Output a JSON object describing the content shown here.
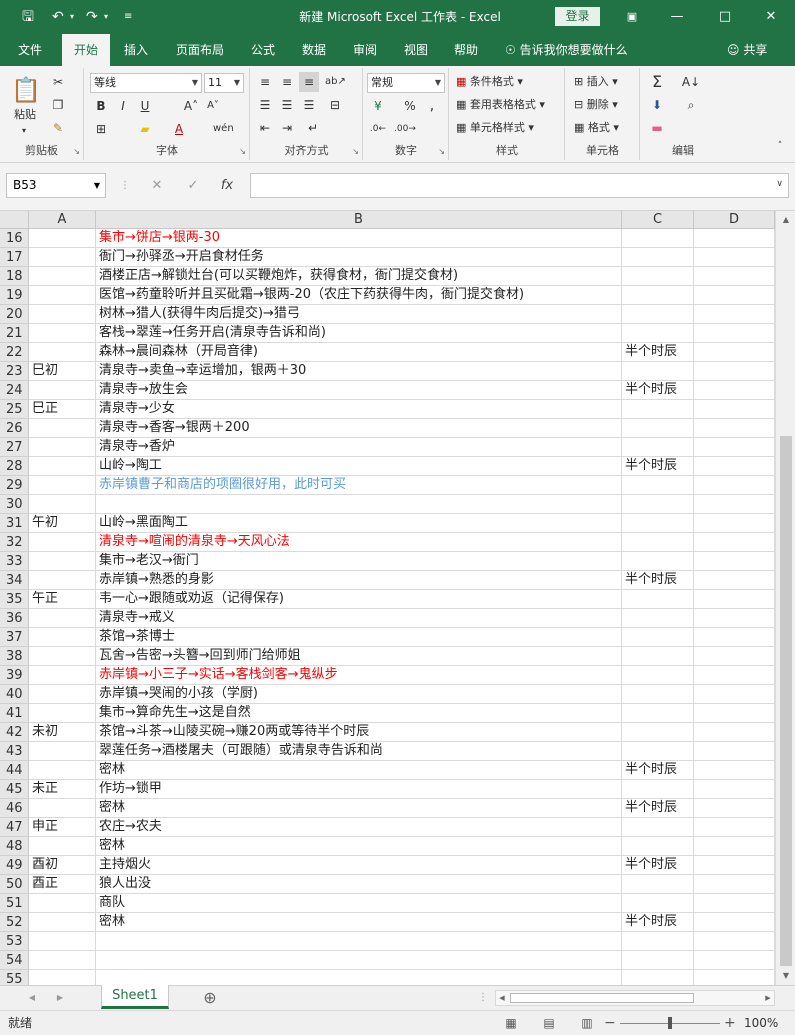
{
  "window": {
    "title": "新建 Microsoft Excel 工作表 - Excel",
    "login": "登录"
  },
  "tabs": [
    "文件",
    "开始",
    "插入",
    "页面布局",
    "公式",
    "数据",
    "审阅",
    "视图",
    "帮助"
  ],
  "tellme": "告诉我你想要做什么",
  "share": "共享",
  "ribbon": {
    "clipboard": {
      "label": "剪贴板",
      "paste": "粘贴"
    },
    "font": {
      "label": "字体",
      "font_name": "等线",
      "font_size": "11"
    },
    "alignment": {
      "label": "对齐方式"
    },
    "number": {
      "label": "数字",
      "format": "常规"
    },
    "styles": {
      "label": "样式",
      "conditional": "条件格式",
      "table": "套用表格格式",
      "cell_styles": "单元格样式"
    },
    "cells": {
      "label": "单元格",
      "insert": "插入",
      "delete": "删除",
      "format": "格式"
    },
    "editing": {
      "label": "编辑"
    }
  },
  "formula_bar": {
    "name_box": "B53",
    "fx": "fx",
    "value": ""
  },
  "columns": [
    "A",
    "B",
    "C",
    "D"
  ],
  "rows": [
    {
      "n": "16",
      "a": "",
      "b": "集市→饼店→银两-30",
      "c": "",
      "style": "red"
    },
    {
      "n": "17",
      "a": "",
      "b": "衙门→孙驿丞→开启食材任务",
      "c": "",
      "style": ""
    },
    {
      "n": "18",
      "a": "",
      "b": "酒楼正店→解锁灶台(可以买鞭炮炸，获得食材，衙门提交食材)",
      "c": "",
      "style": ""
    },
    {
      "n": "19",
      "a": "",
      "b": "医馆→药童聆听并且买砒霜→银两-20（农庄下药获得牛肉，衙门提交食材)",
      "c": "",
      "style": ""
    },
    {
      "n": "20",
      "a": "",
      "b": "树林→猎人(获得牛肉后提交)→猎弓",
      "c": "",
      "style": ""
    },
    {
      "n": "21",
      "a": "",
      "b": "客栈→翠莲→任务开启(清泉寺告诉和尚)",
      "c": "",
      "style": ""
    },
    {
      "n": "22",
      "a": "",
      "b": "森林→晨间森林（开局音律)",
      "c": "半个时辰",
      "style": ""
    },
    {
      "n": "23",
      "a": "巳初",
      "b": "清泉寺→卖鱼→幸运增加，银两＋30",
      "c": "",
      "style": ""
    },
    {
      "n": "24",
      "a": "",
      "b": "清泉寺→放生会",
      "c": "半个时辰",
      "style": ""
    },
    {
      "n": "25",
      "a": "巳正",
      "b": "清泉寺→少女",
      "c": "",
      "style": ""
    },
    {
      "n": "26",
      "a": "",
      "b": "清泉寺→香客→银两＋200",
      "c": "",
      "style": ""
    },
    {
      "n": "27",
      "a": "",
      "b": "清泉寺→香炉",
      "c": "",
      "style": ""
    },
    {
      "n": "28",
      "a": "",
      "b": "山岭→陶工",
      "c": "半个时辰",
      "style": ""
    },
    {
      "n": "29",
      "a": "",
      "b": "赤岸镇曹子和商店的项圈很好用，此时可买",
      "c": "",
      "style": "blue"
    },
    {
      "n": "30",
      "a": "",
      "b": "",
      "c": "",
      "style": ""
    },
    {
      "n": "31",
      "a": "午初",
      "b": "山岭→黑面陶工",
      "c": "",
      "style": ""
    },
    {
      "n": "32",
      "a": "",
      "b": "清泉寺→喧闹的清泉寺→天风心法",
      "c": "",
      "style": "red"
    },
    {
      "n": "33",
      "a": "",
      "b": "集市→老汉→衙门",
      "c": "",
      "style": ""
    },
    {
      "n": "34",
      "a": "",
      "b": "赤岸镇→熟悉的身影",
      "c": "半个时辰",
      "style": ""
    },
    {
      "n": "35",
      "a": "午正",
      "b": "韦一心→跟随或劝返（记得保存)",
      "c": "",
      "style": ""
    },
    {
      "n": "36",
      "a": "",
      "b": "清泉寺→戒义",
      "c": "",
      "style": ""
    },
    {
      "n": "37",
      "a": "",
      "b": "茶馆→茶博士",
      "c": "",
      "style": ""
    },
    {
      "n": "38",
      "a": "",
      "b": "瓦舍→告密→头簪→回到师门给师姐",
      "c": "",
      "style": ""
    },
    {
      "n": "39",
      "a": "",
      "b": "赤岸镇→小三子→实话→客栈剑客→鬼纵步",
      "c": "",
      "style": "red"
    },
    {
      "n": "40",
      "a": "",
      "b": "赤岸镇→哭闹的小孩（学厨)",
      "c": "",
      "style": ""
    },
    {
      "n": "41",
      "a": "",
      "b": "集市→算命先生→这是自然",
      "c": "",
      "style": ""
    },
    {
      "n": "42",
      "a": "未初",
      "b": "茶馆→斗茶→山陵买碗→赚20两或等待半个时辰",
      "c": "",
      "style": ""
    },
    {
      "n": "43",
      "a": "",
      "b": "翠莲任务→酒楼屠夫（可跟随）或清泉寺告诉和尚",
      "c": "",
      "style": ""
    },
    {
      "n": "44",
      "a": "",
      "b": "密林",
      "c": "半个时辰",
      "style": ""
    },
    {
      "n": "45",
      "a": "未正",
      "b": "作坊→锁甲",
      "c": "",
      "style": ""
    },
    {
      "n": "46",
      "a": "",
      "b": "密林",
      "c": "半个时辰",
      "style": ""
    },
    {
      "n": "47",
      "a": "申正",
      "b": "农庄→农夫",
      "c": "",
      "style": ""
    },
    {
      "n": "48",
      "a": "",
      "b": "密林",
      "c": "",
      "style": ""
    },
    {
      "n": "49",
      "a": "酉初",
      "b": "主持烟火",
      "c": "半个时辰",
      "style": ""
    },
    {
      "n": "50",
      "a": "酉正",
      "b": "狼人出没",
      "c": "",
      "style": ""
    },
    {
      "n": "51",
      "a": "",
      "b": "商队",
      "c": "",
      "style": ""
    },
    {
      "n": "52",
      "a": "",
      "b": "密林",
      "c": "半个时辰",
      "style": ""
    },
    {
      "n": "53",
      "a": "",
      "b": "",
      "c": "",
      "style": ""
    },
    {
      "n": "54",
      "a": "",
      "b": "",
      "c": "",
      "style": ""
    },
    {
      "n": "55",
      "a": "",
      "b": "",
      "c": "",
      "style": ""
    }
  ],
  "sheet_tab": "Sheet1",
  "status": {
    "text": "就绪",
    "zoom": "100%",
    "zoom_fraction": 0.5
  }
}
